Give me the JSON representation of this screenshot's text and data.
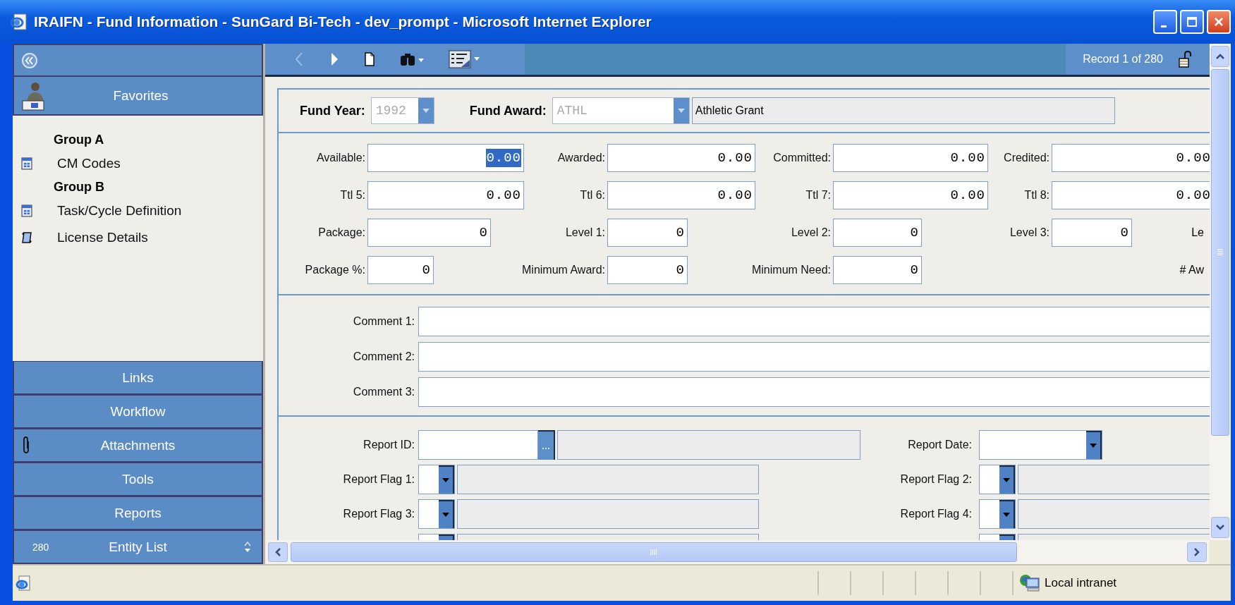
{
  "window": {
    "title": "IRAIFN - Fund Information - SunGard Bi-Tech - dev_prompt - Microsoft Internet Explorer"
  },
  "sidebar": {
    "header": "Favorites",
    "groups": [
      {
        "label": "Group A",
        "items": [
          {
            "label": "CM Codes",
            "kind": "form"
          }
        ]
      },
      {
        "label": "Group B",
        "items": [
          {
            "label": "Task/Cycle Definition",
            "kind": "form"
          },
          {
            "label": "License Details",
            "kind": "scroll"
          }
        ]
      }
    ],
    "panels": [
      {
        "label": "Links",
        "kind": "plain"
      },
      {
        "label": "Workflow",
        "kind": "plain"
      },
      {
        "label": "Attachments",
        "kind": "attachments"
      },
      {
        "label": "Tools",
        "kind": "plain"
      },
      {
        "label": "Reports",
        "kind": "plain"
      },
      {
        "label": "Entity List",
        "kind": "list",
        "count": "280"
      }
    ]
  },
  "toolbar": {
    "record": "Record 1 of 280"
  },
  "header": {
    "fund_year": {
      "label": "Fund Year:",
      "value": "1992",
      "disabled": true
    },
    "fund_award": {
      "label": "Fund Award:",
      "value": "ATHL",
      "disabled": true,
      "description": "Athletic Grant"
    }
  },
  "amounts": [
    {
      "fields": [
        {
          "label": "Available:",
          "value": "0.00",
          "selected": true
        },
        {
          "label": "Awarded:",
          "value": "0.00",
          "selected": false
        },
        {
          "label": "Committed:",
          "value": "0.00",
          "selected": false
        },
        {
          "label": "Credited:",
          "value": "0.00",
          "selected": false
        }
      ]
    },
    {
      "fields": [
        {
          "label": "Ttl 5:",
          "value": "0.00",
          "selected": false
        },
        {
          "label": "Ttl 6:",
          "value": "0.00",
          "selected": false
        },
        {
          "label": "Ttl 7:",
          "value": "0.00",
          "selected": false
        },
        {
          "label": "Ttl 8:",
          "value": "0.00",
          "selected": false
        }
      ]
    },
    {
      "fields": [
        {
          "label": "Package:",
          "value": "0",
          "selected": false
        },
        {
          "label": "Level 1:",
          "value": "0",
          "selected": false
        },
        {
          "label": "Level 2:",
          "value": "0",
          "selected": false
        },
        {
          "label": "Level 3:",
          "value": "0",
          "selected": false
        }
      ],
      "trailing_label": "Le"
    },
    {
      "fields": [
        {
          "label": "Package %:",
          "value": "0",
          "selected": false
        },
        {
          "label": "Minimum Award:",
          "value": "0",
          "selected": false
        },
        {
          "label": "Minimum Need:",
          "value": "0",
          "selected": false
        }
      ],
      "trailing_label": "# Aw"
    }
  ],
  "comments": [
    {
      "label": "Comment 1:"
    },
    {
      "label": "Comment 2:"
    },
    {
      "label": "Comment 3:"
    }
  ],
  "report": {
    "id_label": "Report ID:",
    "date_label": "Report Date:",
    "flags": [
      {
        "label": "Report Flag 1:"
      },
      {
        "label": "Report Flag 2:"
      },
      {
        "label": "Report Flag 3:"
      },
      {
        "label": "Report Flag 4:"
      }
    ]
  },
  "status_bar": {
    "zone": "Local intranet"
  }
}
